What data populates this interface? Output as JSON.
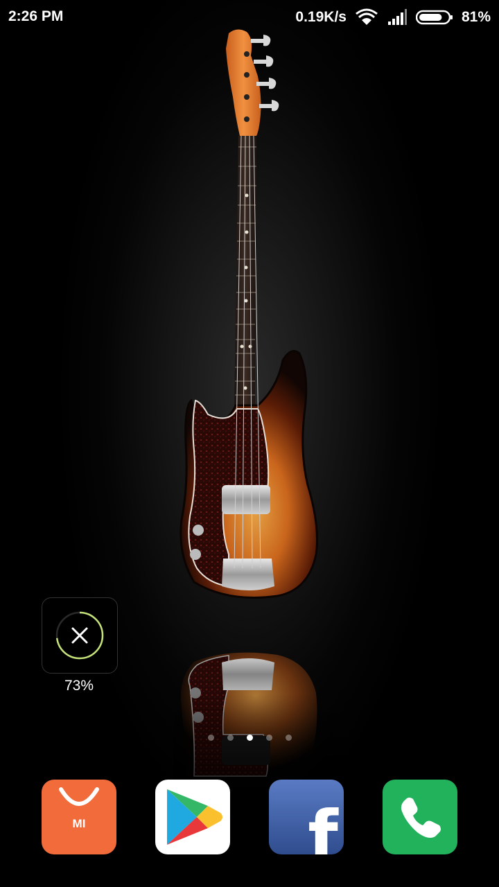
{
  "status_bar": {
    "time": "2:26 PM",
    "network_speed": "0.19K/s",
    "battery_percent": "81%",
    "battery_level": 0.81,
    "icons": [
      "wifi-icon",
      "signal-icon",
      "battery-icon"
    ]
  },
  "wallpaper": {
    "subject": "bass-guitar-icon",
    "colors": {
      "headstock": "#e07a2c",
      "body_edge": "#1a0a05",
      "body_center": "#d98a2e",
      "pickguard": "#3a0f0a"
    }
  },
  "cleaner_widget": {
    "icon": "close-icon",
    "label": "73%",
    "progress": 0.73,
    "ring_color": "#c6e37a"
  },
  "page_indicator": {
    "count": 5,
    "active_index": 2
  },
  "dock": {
    "apps": [
      {
        "icon": "mi-store-icon",
        "text": "MI",
        "color": "#f26b3a"
      },
      {
        "icon": "play-store-icon",
        "color": "#ffffff"
      },
      {
        "icon": "facebook-icon",
        "text": "f",
        "color": "#3b5998"
      },
      {
        "icon": "phone-icon",
        "color": "#22b25c"
      }
    ]
  }
}
